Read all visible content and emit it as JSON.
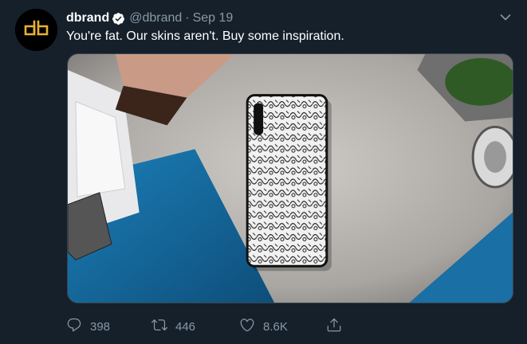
{
  "tweet": {
    "author_name": "dbrand",
    "handle": "@dbrand",
    "separator": "·",
    "date": "Sep 19",
    "text": "You're fat. Our skins aren't. Buy some inspiration.",
    "verified": true
  },
  "actions": {
    "replies": "398",
    "retweets": "446",
    "likes": "8.6K"
  },
  "icons": {
    "avatar": "dbrand-logo",
    "verified": "verified-badge-icon",
    "caret": "chevron-down-icon",
    "reply": "reply-icon",
    "retweet": "retweet-icon",
    "like": "heart-icon",
    "share": "share-icon"
  },
  "colors": {
    "background": "#15202b",
    "secondary_text": "#8899a6",
    "logo_accent": "#e8b033"
  }
}
